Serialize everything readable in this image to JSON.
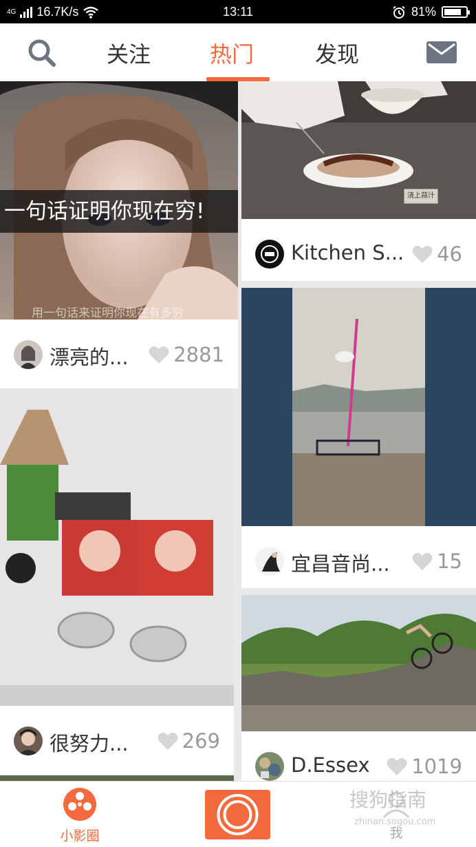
{
  "status_bar": {
    "network_type": "4G",
    "speed": "16.7K/s",
    "time": "13:11",
    "battery": "81%",
    "battery_level": 0.81
  },
  "nav": {
    "tabs": [
      {
        "label": "关注"
      },
      {
        "label": "热门"
      },
      {
        "label": "发现"
      }
    ],
    "active_tab": "热门"
  },
  "feed": {
    "left": [
      {
        "caption": "一句话证明你现在穷!",
        "subtitle": "用一句话来证明你现在有多穷",
        "author": "漂亮的...",
        "likes": "2881"
      },
      {
        "author": "很努力...",
        "likes": "269"
      }
    ],
    "right": [
      {
        "stamp_text": "浇上蒜汁",
        "author": "Kitchen S...",
        "likes": "46"
      },
      {
        "author": "宜昌音尚...",
        "likes": "15"
      },
      {
        "author": "D.Essex",
        "likes": "1019"
      }
    ]
  },
  "bottom_bar": {
    "home_label": "小影圈",
    "me_label": "我"
  },
  "watermark": {
    "text": "搜狗指南",
    "url": "zhinan.sogou.com"
  },
  "colors": {
    "accent": "#f26a3d",
    "gray_text": "#999999"
  }
}
